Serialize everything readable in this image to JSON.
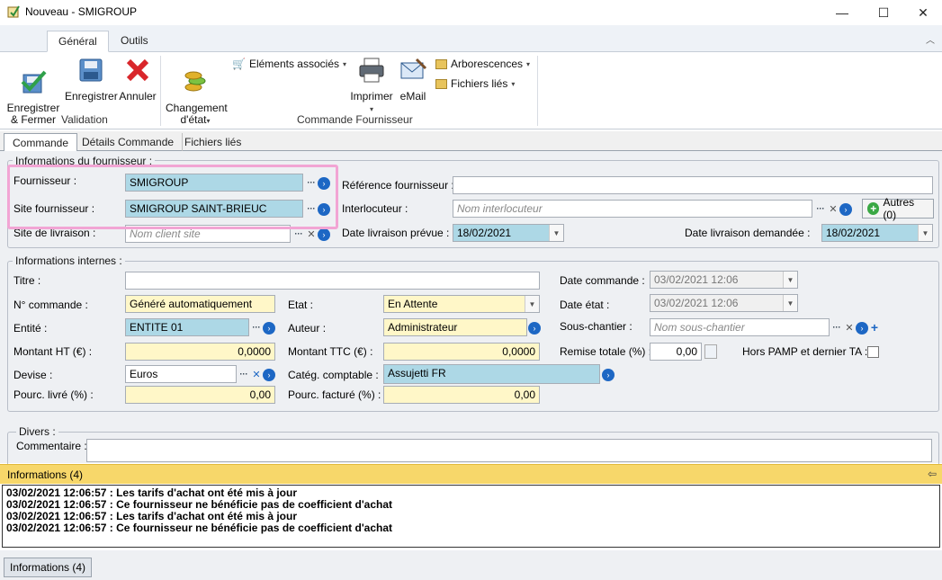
{
  "window": {
    "title": "Nouveau - SMIGROUP",
    "minimize": "—",
    "maximize": "☐",
    "close": "✕"
  },
  "ribbon": {
    "tabs": [
      {
        "label": "Général"
      },
      {
        "label": "Outils"
      }
    ],
    "buttons": {
      "save_close": "Enregistrer\n& Fermer",
      "save": "Enregistrer",
      "cancel": "Annuler",
      "change_state": "Changement\nd'état",
      "related": "Eléments associés",
      "print": "Imprimer",
      "email": "eMail",
      "trees": "Arborescences",
      "linked_files": "Fichiers liés"
    },
    "groups": {
      "validation": "Validation",
      "order": "Commande Fournisseur"
    }
  },
  "form_tabs": [
    {
      "label": "Commande"
    },
    {
      "label": "Détails Commande"
    },
    {
      "label": "Fichiers liés"
    }
  ],
  "supplier_info": {
    "title": "Informations du fournisseur :",
    "fournisseur_label": "Fournisseur :",
    "fournisseur_value": "SMIGROUP",
    "site_label": "Site fournisseur :",
    "site_value": "SMIGROUP SAINT-BRIEUC",
    "livraison_label": "Site de livraison :",
    "livraison_placeholder": "Nom client site",
    "ref_label": "Référence fournisseur :",
    "ref_value": "",
    "interlocuteur_label": "Interlocuteur :",
    "interlocuteur_placeholder": "Nom interlocuteur",
    "autres_button": "Autres (0)",
    "date_prevue_label": "Date livraison prévue :",
    "date_prevue_value": "18/02/2021",
    "date_demandee_label": "Date livraison demandée :",
    "date_demandee_value": "18/02/2021"
  },
  "internal_info": {
    "title": "Informations internes :",
    "titre_label": "Titre :",
    "titre_value": "",
    "commande_label": "N° commande :",
    "commande_value": "Généré automatiquement",
    "entite_label": "Entité :",
    "entite_value": "ENTITE 01",
    "montant_ht_label": "Montant HT (€) :",
    "montant_ht_value": "0,0000",
    "devise_label": "Devise :",
    "devise_value": "Euros",
    "pourc_livre_label": "Pourc. livré (%) :",
    "pourc_livre_value": "0,00",
    "etat_label": "Etat :",
    "etat_value": "En Attente",
    "auteur_label": "Auteur :",
    "auteur_value": "Administrateur",
    "montant_ttc_label": "Montant TTC (€) :",
    "montant_ttc_value": "0,0000",
    "categ_label": "Catég. comptable :",
    "categ_value": "Assujetti FR",
    "pourc_facture_label": "Pourc. facturé (%) :",
    "pourc_facture_value": "0,00",
    "date_commande_label": "Date commande :",
    "date_commande_value": "03/02/2021  12:06",
    "date_etat_label": "Date état :",
    "date_etat_value": "03/02/2021  12:06",
    "sous_chantier_label": "Sous-chantier :",
    "sous_chantier_placeholder": "Nom sous-chantier",
    "remise_label": "Remise totale (%) :",
    "remise_value": "0,00",
    "hors_pamp_label": "Hors PAMP et dernier TA :"
  },
  "divers": {
    "title": "Divers :",
    "commentaire_label": "Commentaire :",
    "commentaire_value": ""
  },
  "info_panel": {
    "title": "Informations (4)",
    "messages": [
      "03/02/2021 12:06:57 : Les tarifs d'achat ont été mis à jour",
      "03/02/2021 12:06:57 : Ce fournisseur ne bénéficie pas de coefficient d'achat",
      "03/02/2021 12:06:57 : Les tarifs d'achat ont été mis à jour",
      "03/02/2021 12:06:57 : Ce fournisseur ne bénéficie pas de coefficient d'achat"
    ],
    "bottom_tab": "Informations (4)"
  }
}
